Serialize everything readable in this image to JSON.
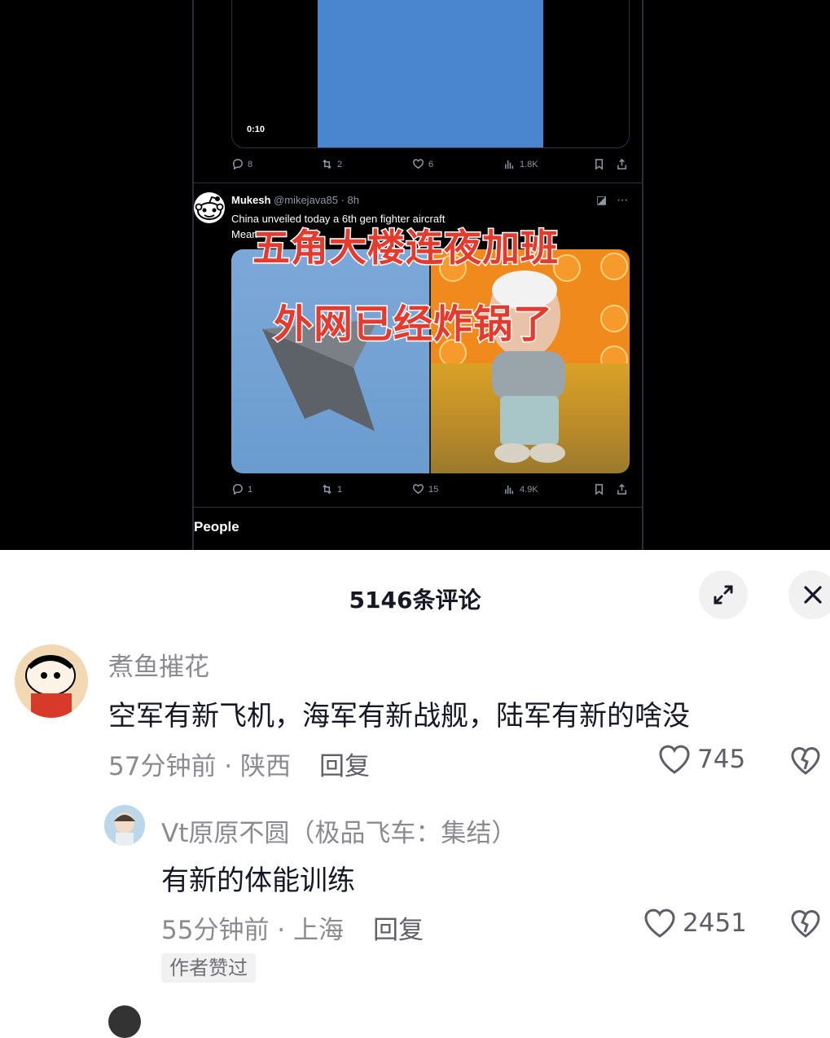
{
  "video": {
    "top_card": {
      "duration": "0:10"
    },
    "top_actions": {
      "replies": "8",
      "reposts": "2",
      "likes": "6",
      "views": "1.8K"
    },
    "tweet": {
      "author": "Mukesh",
      "handle": "@mikejava85 · 8h",
      "text_line1": "China unveiled today a 6th gen fighter aircraft",
      "text_line2": "Mean"
    },
    "overlay_line1": "五角大楼连夜加班",
    "overlay_line2": "外网已经炸锅了",
    "tweet_actions": {
      "replies": "1",
      "reposts": "1",
      "likes": "15",
      "views": "4.9K"
    },
    "section_label": "People"
  },
  "comments_panel": {
    "title": "5146条评论",
    "comments": [
      {
        "username": "煮鱼摧花",
        "text": "空军有新飞机，海军有新战舰，陆军有新的啥没",
        "time_location": "57分钟前 · 陕西",
        "reply_label": "回复",
        "likes": "745"
      },
      {
        "username": "Vt原原不圆（极品飞车：集结）",
        "text": "有新的体能训练",
        "time_location": "55分钟前 · 上海",
        "reply_label": "回复",
        "likes": "2451",
        "badge": "作者赞过"
      }
    ]
  },
  "colors": {
    "accent_red": "#e53a2e",
    "video_bg": "#000000",
    "panel_bg": "#ffffff"
  }
}
